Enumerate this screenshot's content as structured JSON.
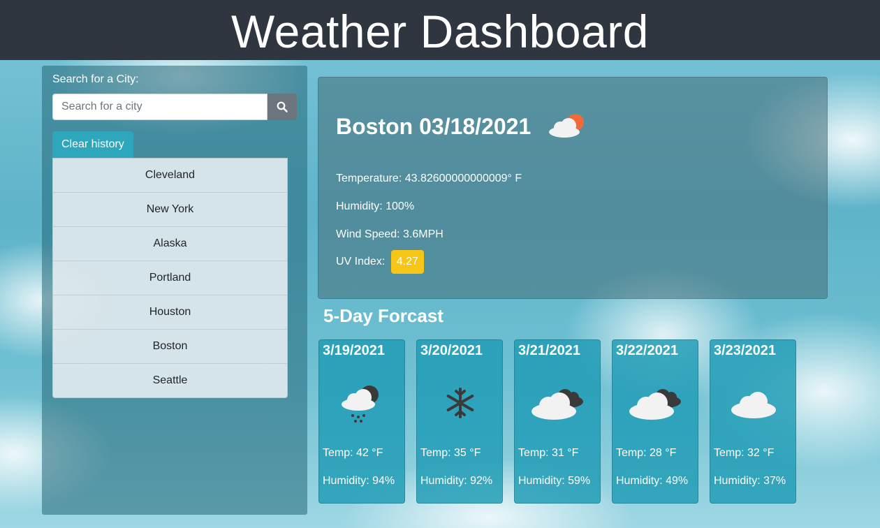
{
  "app_title": "Weather Dashboard",
  "sidebar": {
    "search_label": "Search for a City:",
    "search_placeholder": "Search for a city",
    "search_icon": "search-icon",
    "clear_label": "Clear history",
    "history": [
      "Cleveland",
      "New York",
      "Alaska",
      "Portland",
      "Houston",
      "Boston",
      "Seattle"
    ]
  },
  "current": {
    "title": "Boston 03/18/2021",
    "icon": "partly-cloudy-icon",
    "temperature": "Temperature: 43.82600000000009° F",
    "humidity": "Humidity: 100%",
    "wind": "Wind Speed: 3.6MPH",
    "uv_label": "UV Index:",
    "uv_value": "4.27",
    "uv_color": "#f5c518"
  },
  "forecast": {
    "title": "5-Day Forcast",
    "days": [
      {
        "date": "3/19/2021",
        "icon": "rain-cloud-icon",
        "temp": "Temp: 42 °F",
        "humidity": "Humidity: 94%"
      },
      {
        "date": "3/20/2021",
        "icon": "snowflake-icon",
        "temp": "Temp: 35 °F",
        "humidity": "Humidity: 92%"
      },
      {
        "date": "3/21/2021",
        "icon": "broken-clouds-icon",
        "temp": "Temp: 31 °F",
        "humidity": "Humidity: 59%"
      },
      {
        "date": "3/22/2021",
        "icon": "broken-clouds-icon",
        "temp": "Temp: 28 °F",
        "humidity": "Humidity: 49%"
      },
      {
        "date": "3/23/2021",
        "icon": "cloud-icon",
        "temp": "Temp: 32 °F",
        "humidity": "Humidity: 37%"
      }
    ]
  }
}
